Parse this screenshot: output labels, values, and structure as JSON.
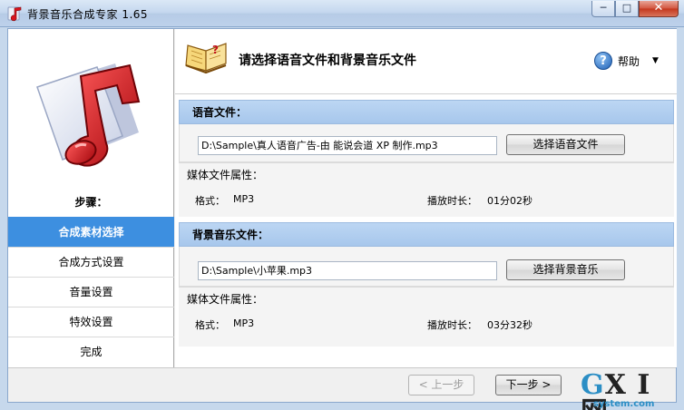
{
  "window": {
    "title": "背景音乐合成专家 1.65",
    "controls": {
      "minimize": "─",
      "maximize": "□",
      "close": "✕"
    }
  },
  "sidebar": {
    "steps_title": "步骤：",
    "steps": [
      {
        "label": "合成素材选择",
        "active": true
      },
      {
        "label": "合成方式设置",
        "active": false
      },
      {
        "label": "音量设置",
        "active": false
      },
      {
        "label": "特效设置",
        "active": false
      },
      {
        "label": "完成",
        "active": false
      }
    ]
  },
  "header": {
    "title": "请选择语音文件和背景音乐文件",
    "help_label": "帮助",
    "help_icon_glyph": "?",
    "dropdown_glyph": "▼"
  },
  "voice": {
    "section_title": "语音文件：",
    "path": "D:\\Sample\\真人语音广告-由 能说会道 XP 制作.mp3",
    "button": "选择语音文件",
    "props_title": "媒体文件属性：",
    "format_label": "格式：",
    "format_value": "MP3",
    "duration_label": "播放时长：",
    "duration_value": "01分02秒"
  },
  "music": {
    "section_title": "背景音乐文件：",
    "path": "D:\\Sample\\小苹果.mp3",
    "button": "选择背景音乐",
    "props_title": "媒体文件属性：",
    "format_label": "格式：",
    "format_value": "MP3",
    "duration_label": "播放时长：",
    "duration_value": "03分32秒"
  },
  "footer": {
    "prev": "< 上一步",
    "next": "下一步 >"
  },
  "watermark": {
    "logo_g": "G",
    "logo_rest": "X I 网",
    "site": "system.com"
  },
  "colors": {
    "active_step": "#3d8fe0",
    "section_header": "#bcd6f3",
    "note_red": "#d9141c"
  }
}
